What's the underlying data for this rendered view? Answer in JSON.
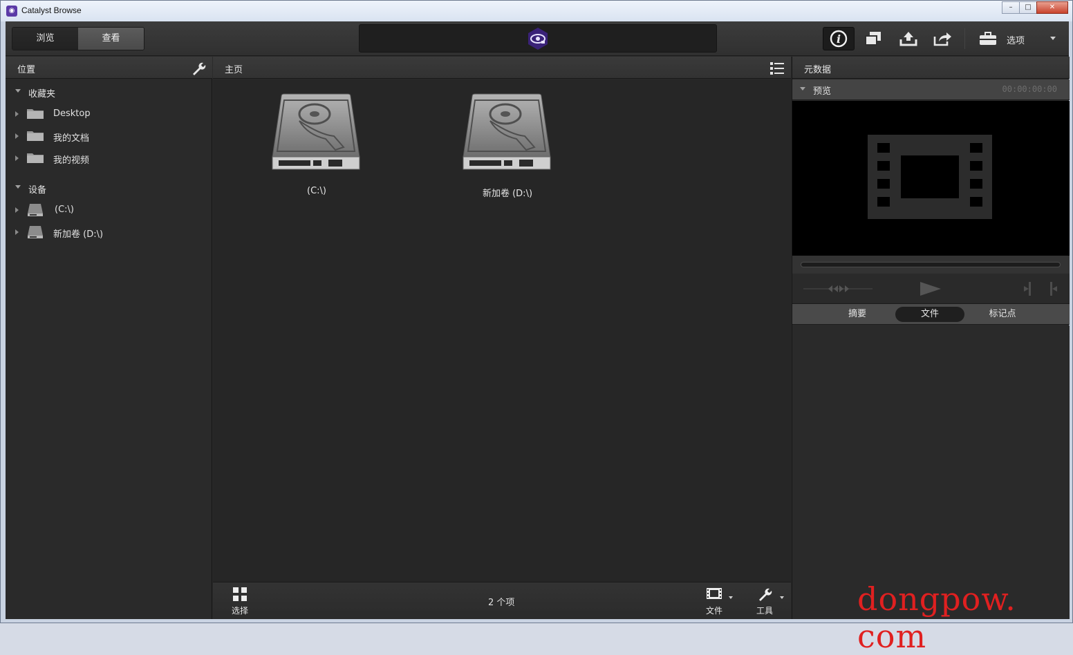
{
  "window": {
    "title": "Catalyst Browse",
    "min": "–",
    "max": "□",
    "close": "✕"
  },
  "toolbar": {
    "mode_tabs": [
      {
        "label": "浏览",
        "active": false
      },
      {
        "label": "查看",
        "active": true
      }
    ],
    "options_label": "选项"
  },
  "locations": {
    "header": "位置",
    "sections": [
      {
        "label": "收藏夹",
        "items": [
          "Desktop",
          "我的文档",
          "我的视频"
        ]
      },
      {
        "label": "设备",
        "items": [
          "(C:\\)",
          "新加卷 (D:\\)"
        ]
      }
    ]
  },
  "center": {
    "header": "主页",
    "drives": [
      "(C:\\)",
      "新加卷 (D:\\)"
    ],
    "footer": {
      "select_label": "选择",
      "item_count": "2 个项",
      "file_label": "文件",
      "tools_label": "工具"
    }
  },
  "metadata": {
    "header": "元数据",
    "preview_label": "预览",
    "timecode": "00:00:00:00",
    "tabs": [
      {
        "label": "摘要",
        "active": false
      },
      {
        "label": "文件",
        "active": true
      },
      {
        "label": "标记点",
        "active": false
      }
    ]
  },
  "watermark": "dongpow. com"
}
